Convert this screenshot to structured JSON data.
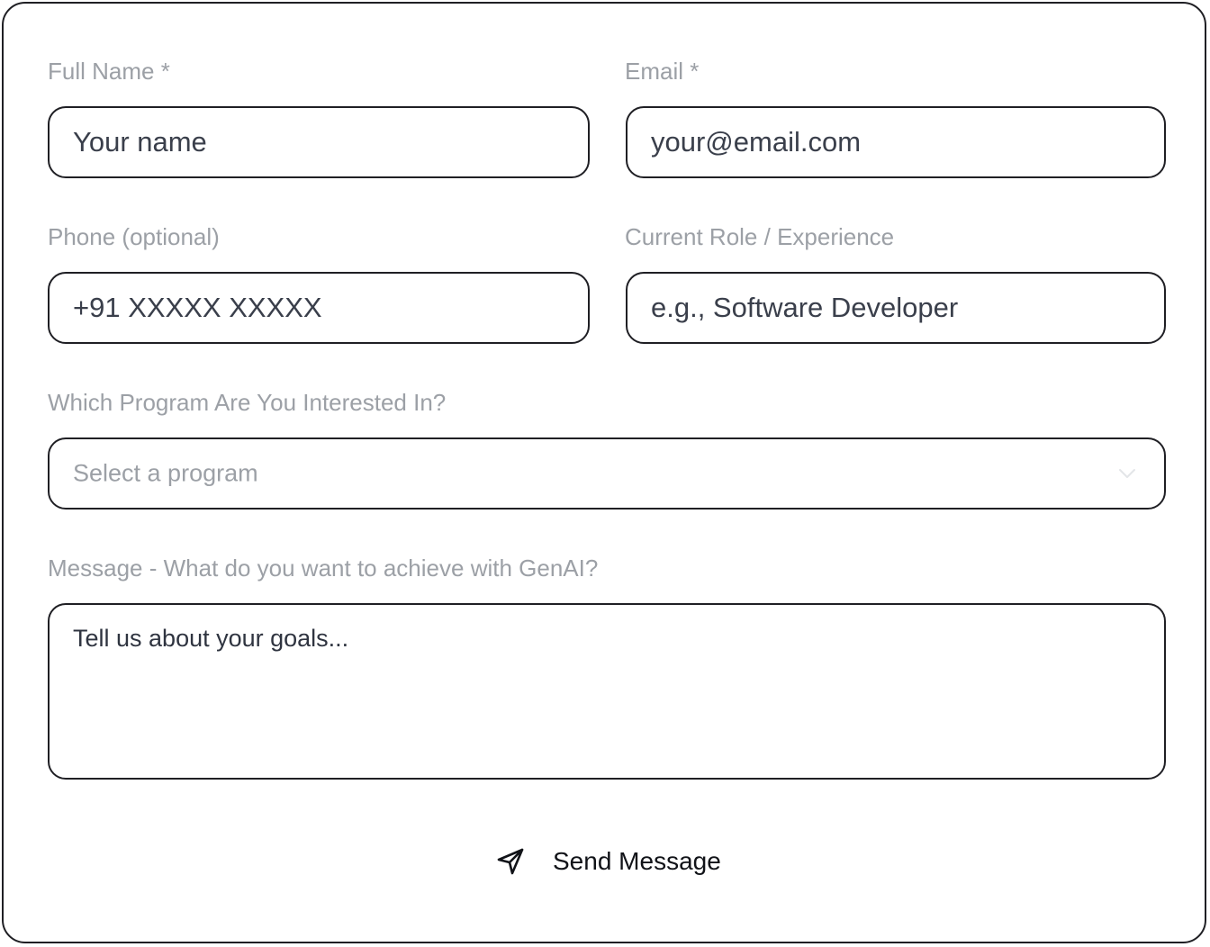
{
  "form": {
    "full_name": {
      "label": "Full Name *",
      "placeholder": "Your name"
    },
    "email": {
      "label": "Email *",
      "placeholder": "your@email.com"
    },
    "phone": {
      "label": "Phone (optional)",
      "placeholder": "+91 XXXXX XXXXX"
    },
    "role": {
      "label": "Current Role / Experience",
      "placeholder": "e.g., Software Developer"
    },
    "program": {
      "label": "Which Program Are You Interested In?",
      "selected": "Select a program",
      "icon": "chevron-down-icon"
    },
    "message": {
      "label": "Message - What do you want to achieve with GenAI?",
      "placeholder": "Tell us about your goals..."
    },
    "submit": {
      "label": "Send Message",
      "icon": "send-icon"
    }
  },
  "colors": {
    "border": "#1f1f24",
    "label": "#9ca0a6",
    "input_text": "#3a3f4b",
    "button_text": "#111318"
  }
}
